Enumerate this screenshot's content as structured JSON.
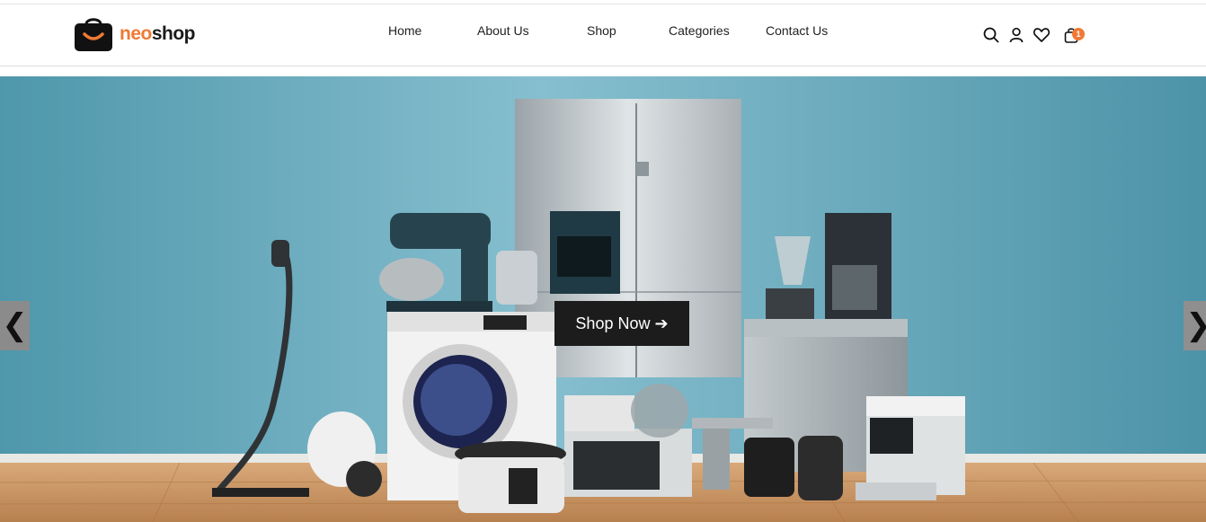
{
  "brand": {
    "part1": "neo",
    "part2": "shop",
    "accent": "#f07a35"
  },
  "nav": [
    {
      "label": "Home"
    },
    {
      "label": "About Us"
    },
    {
      "label": "Shop"
    },
    {
      "label": "Categories"
    },
    {
      "label": "Contact Us"
    }
  ],
  "header_icons": [
    "search-icon",
    "user-icon",
    "heart-icon",
    "shopping-bag-icon"
  ],
  "cart": {
    "count": "1"
  },
  "hero": {
    "cta_label": "Shop Now ➔",
    "prev_glyph": "❮",
    "next_glyph": "❯"
  }
}
